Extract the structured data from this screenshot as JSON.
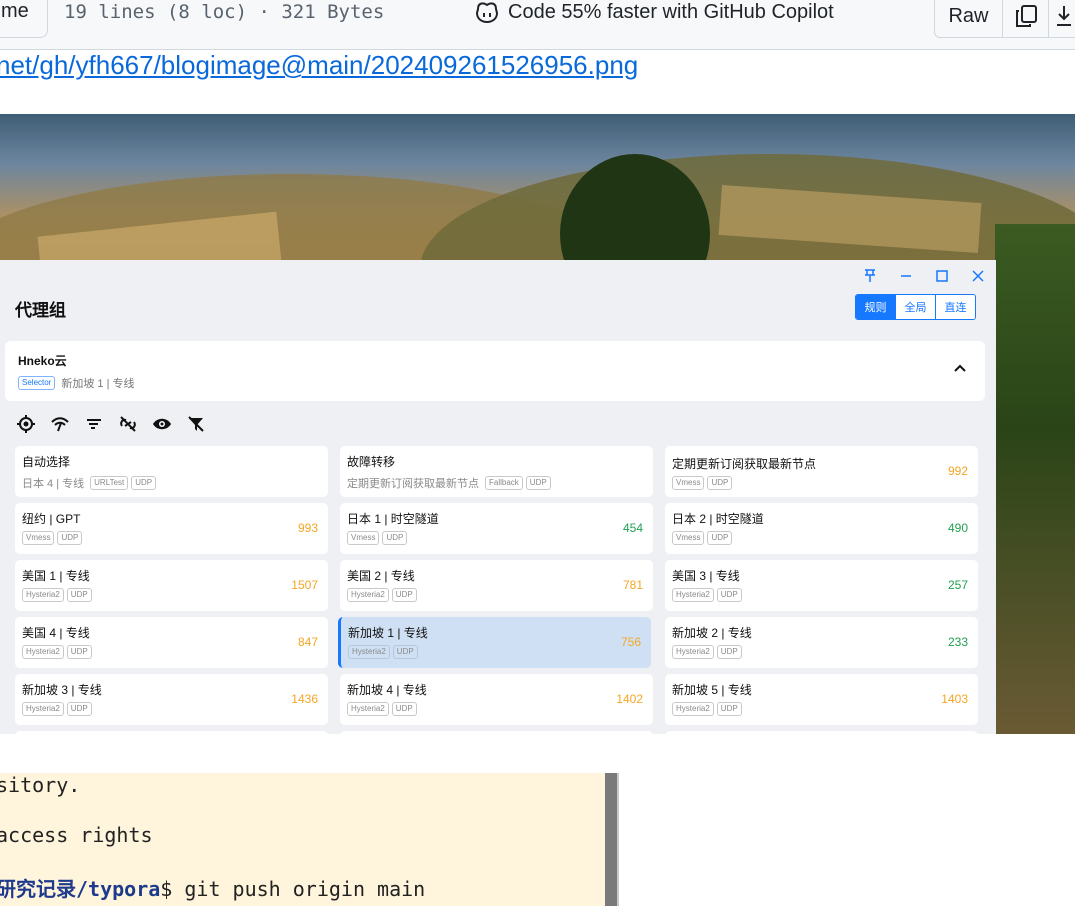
{
  "header": {
    "tab_label": "me",
    "file_info": "19 lines (8 loc) · 321 Bytes",
    "copilot_text": "Code 55% faster with GitHub Copilot",
    "raw_label": "Raw"
  },
  "image_link": "net/gh/yfh667/blogimage@main/202409261526956.png",
  "app": {
    "title": "代理组",
    "modes": [
      {
        "label": "规则",
        "active": true
      },
      {
        "label": "全局",
        "active": false
      },
      {
        "label": "直连",
        "active": false
      }
    ],
    "group": {
      "name": "Hneko云",
      "type_tag": "Selector",
      "current": "新加坡 1 | 专线"
    },
    "nodes": [
      {
        "name": "自动选择",
        "sub": "日本 4 | 专线",
        "tags": [
          "URLTest",
          "UDP"
        ],
        "delay": "",
        "color": ""
      },
      {
        "name": "故障转移",
        "sub": "定期更新订阅获取最新节点",
        "tags": [
          "Fallback",
          "UDP"
        ],
        "delay": "",
        "color": ""
      },
      {
        "name": "定期更新订阅获取最新节点",
        "sub": "",
        "tags": [
          "Vmess",
          "UDP"
        ],
        "delay": "992",
        "color": "orange"
      },
      {
        "name": "纽约 | GPT",
        "sub": "",
        "tags": [
          "Vmess",
          "UDP"
        ],
        "delay": "993",
        "color": "orange"
      },
      {
        "name": "日本 1 | 时空隧道",
        "sub": "",
        "tags": [
          "Vmess",
          "UDP"
        ],
        "delay": "454",
        "color": "green"
      },
      {
        "name": "日本 2 | 时空隧道",
        "sub": "",
        "tags": [
          "Vmess",
          "UDP"
        ],
        "delay": "490",
        "color": "green"
      },
      {
        "name": "美国 1 | 专线",
        "sub": "",
        "tags": [
          "Hysteria2",
          "UDP"
        ],
        "delay": "1507",
        "color": "orange"
      },
      {
        "name": "美国 2 | 专线",
        "sub": "",
        "tags": [
          "Hysteria2",
          "UDP"
        ],
        "delay": "781",
        "color": "orange"
      },
      {
        "name": "美国 3 | 专线",
        "sub": "",
        "tags": [
          "Hysteria2",
          "UDP"
        ],
        "delay": "257",
        "color": "green"
      },
      {
        "name": "美国 4 | 专线",
        "sub": "",
        "tags": [
          "Hysteria2",
          "UDP"
        ],
        "delay": "847",
        "color": "orange"
      },
      {
        "name": "新加坡 1 | 专线",
        "sub": "",
        "tags": [
          "Hysteria2",
          "UDP"
        ],
        "delay": "756",
        "color": "orange",
        "selected": true
      },
      {
        "name": "新加坡 2 | 专线",
        "sub": "",
        "tags": [
          "Hysteria2",
          "UDP"
        ],
        "delay": "233",
        "color": "green"
      },
      {
        "name": "新加坡 3 | 专线",
        "sub": "",
        "tags": [
          "Hysteria2",
          "UDP"
        ],
        "delay": "1436",
        "color": "orange"
      },
      {
        "name": "新加坡 4 | 专线",
        "sub": "",
        "tags": [
          "Hysteria2",
          "UDP"
        ],
        "delay": "1402",
        "color": "orange"
      },
      {
        "name": "新加坡 5 | 专线",
        "sub": "",
        "tags": [
          "Hysteria2",
          "UDP"
        ],
        "delay": "1403",
        "color": "orange"
      }
    ]
  },
  "terminal": {
    "line1": "sitory.",
    "line2": "access rights",
    "line3_path": "研究记录/typora",
    "line3_cmd": "$ git push origin main"
  },
  "colors": {
    "accent": "#1677ff",
    "link": "#0969da",
    "delay_orange": "#f5a623",
    "delay_green": "#20a050"
  }
}
